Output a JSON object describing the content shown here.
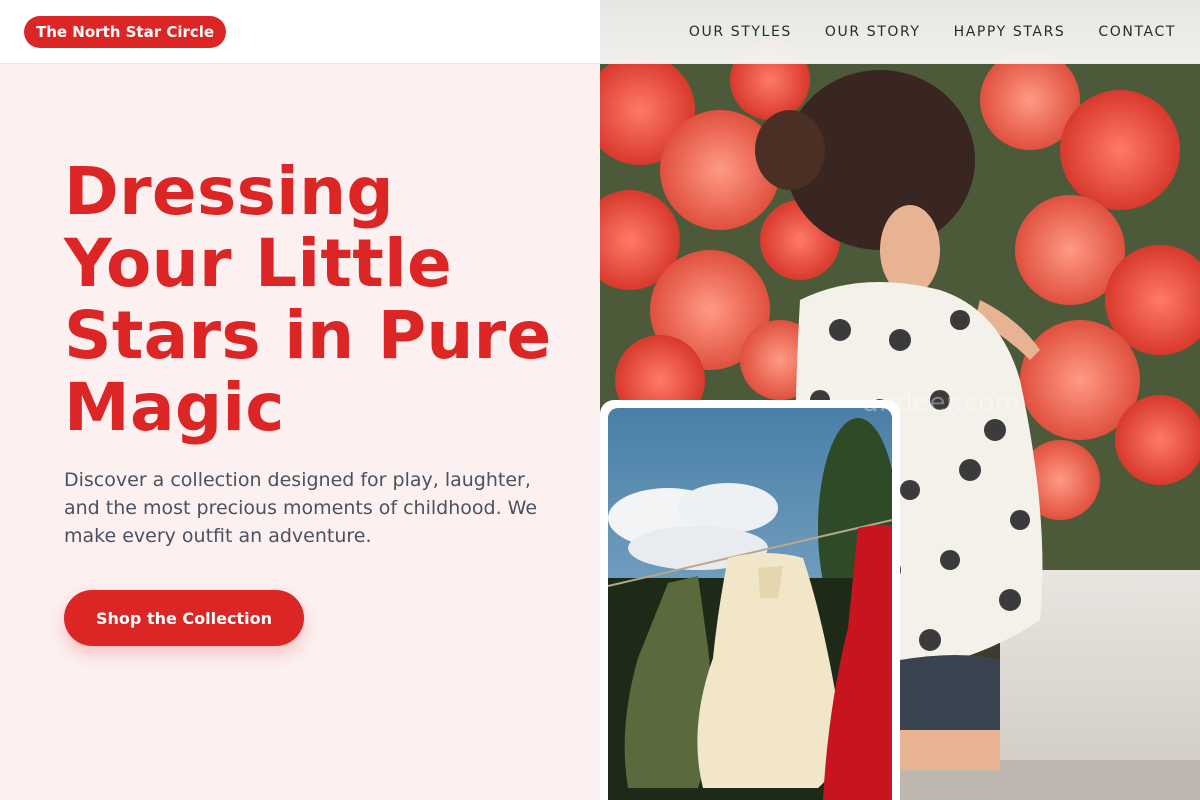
{
  "brand": {
    "name": "The North Star Circle"
  },
  "nav": {
    "items": [
      {
        "label": "OUR STYLES"
      },
      {
        "label": "OUR STORY"
      },
      {
        "label": "HAPPY STARS"
      },
      {
        "label": "CONTACT"
      }
    ]
  },
  "hero": {
    "headline": "Dressing Your Little Stars in Pure Magic",
    "subtext": "Discover a collection designed for play, laughter, and the most precious moments of childhood. We make every outfit an adventure.",
    "cta_label": "Shop the Collection"
  },
  "images": {
    "main_watermark": "undeer.com"
  },
  "colors": {
    "accent": "#dc2626",
    "background": "#fdf0f0",
    "body_text": "#4b5160"
  }
}
